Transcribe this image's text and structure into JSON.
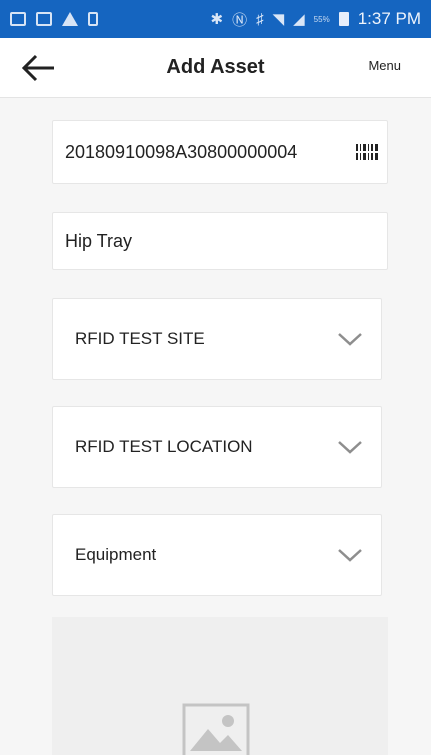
{
  "status_bar": {
    "time": "1:37 PM",
    "battery_percent": "55%",
    "icons": [
      "message-icon",
      "gallery-icon",
      "drive-icon",
      "lock-icon",
      "bluetooth-icon",
      "nfc-icon",
      "mute-icon",
      "wifi-icon",
      "signal-icon",
      "battery-icon"
    ]
  },
  "header": {
    "title": "Add Asset",
    "menu_label": "Menu",
    "back_icon": "arrow-left-icon"
  },
  "form": {
    "asset_id": "20180910098A30800000004",
    "asset_name": "Hip Tray",
    "site": "RFID TEST SITE",
    "location": "RFID TEST LOCATION",
    "category": "Equipment"
  },
  "colors": {
    "status_bar": "#1565c0",
    "background": "#f6f6f6",
    "field_bg": "#ffffff",
    "chevron": "#8e8e8e"
  }
}
